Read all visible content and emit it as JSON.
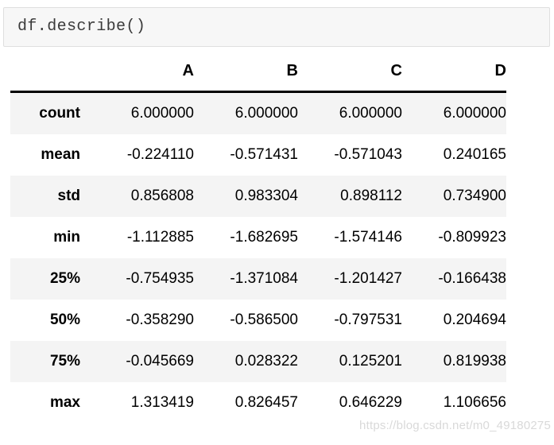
{
  "code_cell": {
    "source": "df.describe()"
  },
  "table": {
    "corner_label": "",
    "columns": [
      "A",
      "B",
      "C",
      "D"
    ],
    "index": [
      "count",
      "mean",
      "std",
      "min",
      "25%",
      "50%",
      "75%",
      "max"
    ],
    "rows": [
      {
        "label": "count",
        "values": [
          "6.000000",
          "6.000000",
          "6.000000",
          "6.000000"
        ]
      },
      {
        "label": "mean",
        "values": [
          "-0.224110",
          "-0.571431",
          "-0.571043",
          "0.240165"
        ]
      },
      {
        "label": "std",
        "values": [
          "0.856808",
          "0.983304",
          "0.898112",
          "0.734900"
        ]
      },
      {
        "label": "min",
        "values": [
          "-1.112885",
          "-1.682695",
          "-1.574146",
          "-0.809923"
        ]
      },
      {
        "label": "25%",
        "values": [
          "-0.754935",
          "-1.371084",
          "-1.201427",
          "-0.166438"
        ]
      },
      {
        "label": "50%",
        "values": [
          "-0.358290",
          "-0.586500",
          "-0.797531",
          "0.204694"
        ]
      },
      {
        "label": "75%",
        "values": [
          "-0.045669",
          "0.028322",
          "0.125201",
          "0.819938"
        ]
      },
      {
        "label": "max",
        "values": [
          "1.313419",
          "0.826457",
          "0.646229",
          "1.106656"
        ]
      }
    ]
  },
  "watermark": {
    "text": "https://blog.csdn.net/m0_49180275"
  },
  "colors": {
    "code_cell_bg": "#f7f7f7",
    "code_cell_border": "#dfdfdf",
    "stripe_bg": "#f4f4f4",
    "rule": "#000000",
    "text": "#000000",
    "watermark": "#d9d9d9"
  },
  "chart_data": {
    "type": "table",
    "title": "df.describe()",
    "categories": [
      "A",
      "B",
      "C",
      "D"
    ],
    "index": [
      "count",
      "mean",
      "std",
      "min",
      "25%",
      "50%",
      "75%",
      "max"
    ],
    "series": [
      {
        "name": "A",
        "values": [
          6.0,
          -0.22411,
          0.856808,
          -1.112885,
          -0.754935,
          -0.35829,
          -0.045669,
          1.313419
        ]
      },
      {
        "name": "B",
        "values": [
          6.0,
          -0.571431,
          0.983304,
          -1.682695,
          -1.371084,
          -0.5865,
          0.028322,
          0.826457
        ]
      },
      {
        "name": "C",
        "values": [
          6.0,
          -0.571043,
          0.898112,
          -1.574146,
          -1.201427,
          -0.797531,
          0.125201,
          0.646229
        ]
      },
      {
        "name": "D",
        "values": [
          6.0,
          0.240165,
          0.7349,
          -0.809923,
          -0.166438,
          0.204694,
          0.819938,
          1.106656
        ]
      }
    ],
    "xlabel": "",
    "ylabel": "",
    "grid": false,
    "legend": "none"
  }
}
